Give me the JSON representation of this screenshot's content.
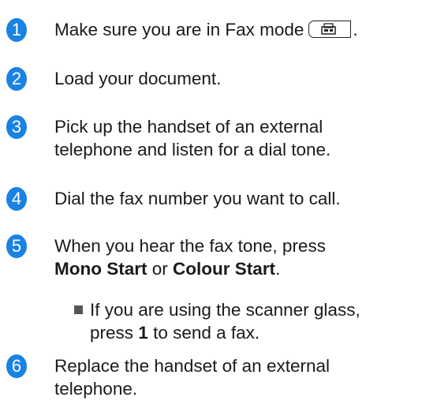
{
  "steps": [
    {
      "number": "1",
      "text": "Make sure you are in Fax mode"
    },
    {
      "number": "2",
      "text": "Load your document."
    },
    {
      "number": "3",
      "line1": "Pick up the handset of an external",
      "line2": "telephone and listen for a dial tone."
    },
    {
      "number": "4",
      "text": "Dial the fax number you want to call."
    },
    {
      "number": "5",
      "line1": "When you hear the fax tone, press",
      "bold1": "Mono Start",
      "or": "or",
      "bold2": "Colour Start",
      "period": ".",
      "bullet_line1": "If you are using the scanner glass,",
      "bullet_press": "press",
      "bullet_key": "1",
      "bullet_rest": "to send a fax."
    },
    {
      "number": "6",
      "line1": "Replace the handset of an external",
      "line2": "telephone."
    }
  ],
  "icons": {
    "fax_mode_key": "fax-mode-key-icon"
  },
  "colors": {
    "step_number_bg": "#1a82e2"
  }
}
